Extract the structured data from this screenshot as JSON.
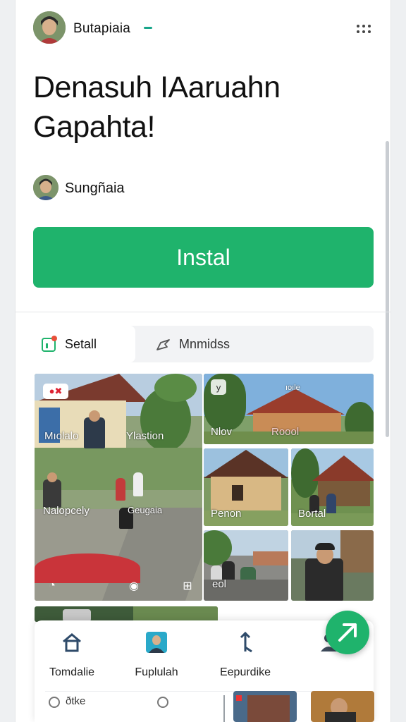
{
  "header": {
    "app_name": "Butapiaia",
    "avatar_icon": "person-avatar",
    "more_icon": "more-dots-icon"
  },
  "title": {
    "line1": "Denasuh IAaruahn",
    "line2": "Gapahta!"
  },
  "author": {
    "name": "Sungñaia"
  },
  "install_button": {
    "label": "Instal",
    "color": "#1fb36c"
  },
  "tabs": [
    {
      "label": "Setall",
      "icon": "details-icon",
      "active": true
    },
    {
      "label": "Mnmidss",
      "icon": "share-arrow-icon",
      "active": false
    }
  ],
  "gallery": {
    "large_photo": {
      "labels": [
        "Mıolalo",
        "Ylastion",
        "Nalopcely",
        "Geugaia"
      ]
    },
    "photo_top_right": {
      "labels": [
        "Nlov",
        "Roool",
        "ıoıle"
      ]
    },
    "photo_mid_left": {
      "labels": [
        "Penon"
      ]
    },
    "photo_mid_right": {
      "labels": [
        "Bortal"
      ]
    },
    "photo_bottom_left": {
      "labels": [
        "eol"
      ]
    }
  },
  "bottom_nav": {
    "items": [
      {
        "label": "Tomdalie",
        "icon": "home-icon"
      },
      {
        "label": "Fuplulah",
        "icon": "profile-card-icon"
      },
      {
        "label": "Eepurdike",
        "icon": "pin-icon"
      }
    ],
    "people_icon": "people-icon",
    "footer_text": "ðtke"
  },
  "fab": {
    "icon": "send-arrow-icon",
    "color": "#1fb36c"
  }
}
